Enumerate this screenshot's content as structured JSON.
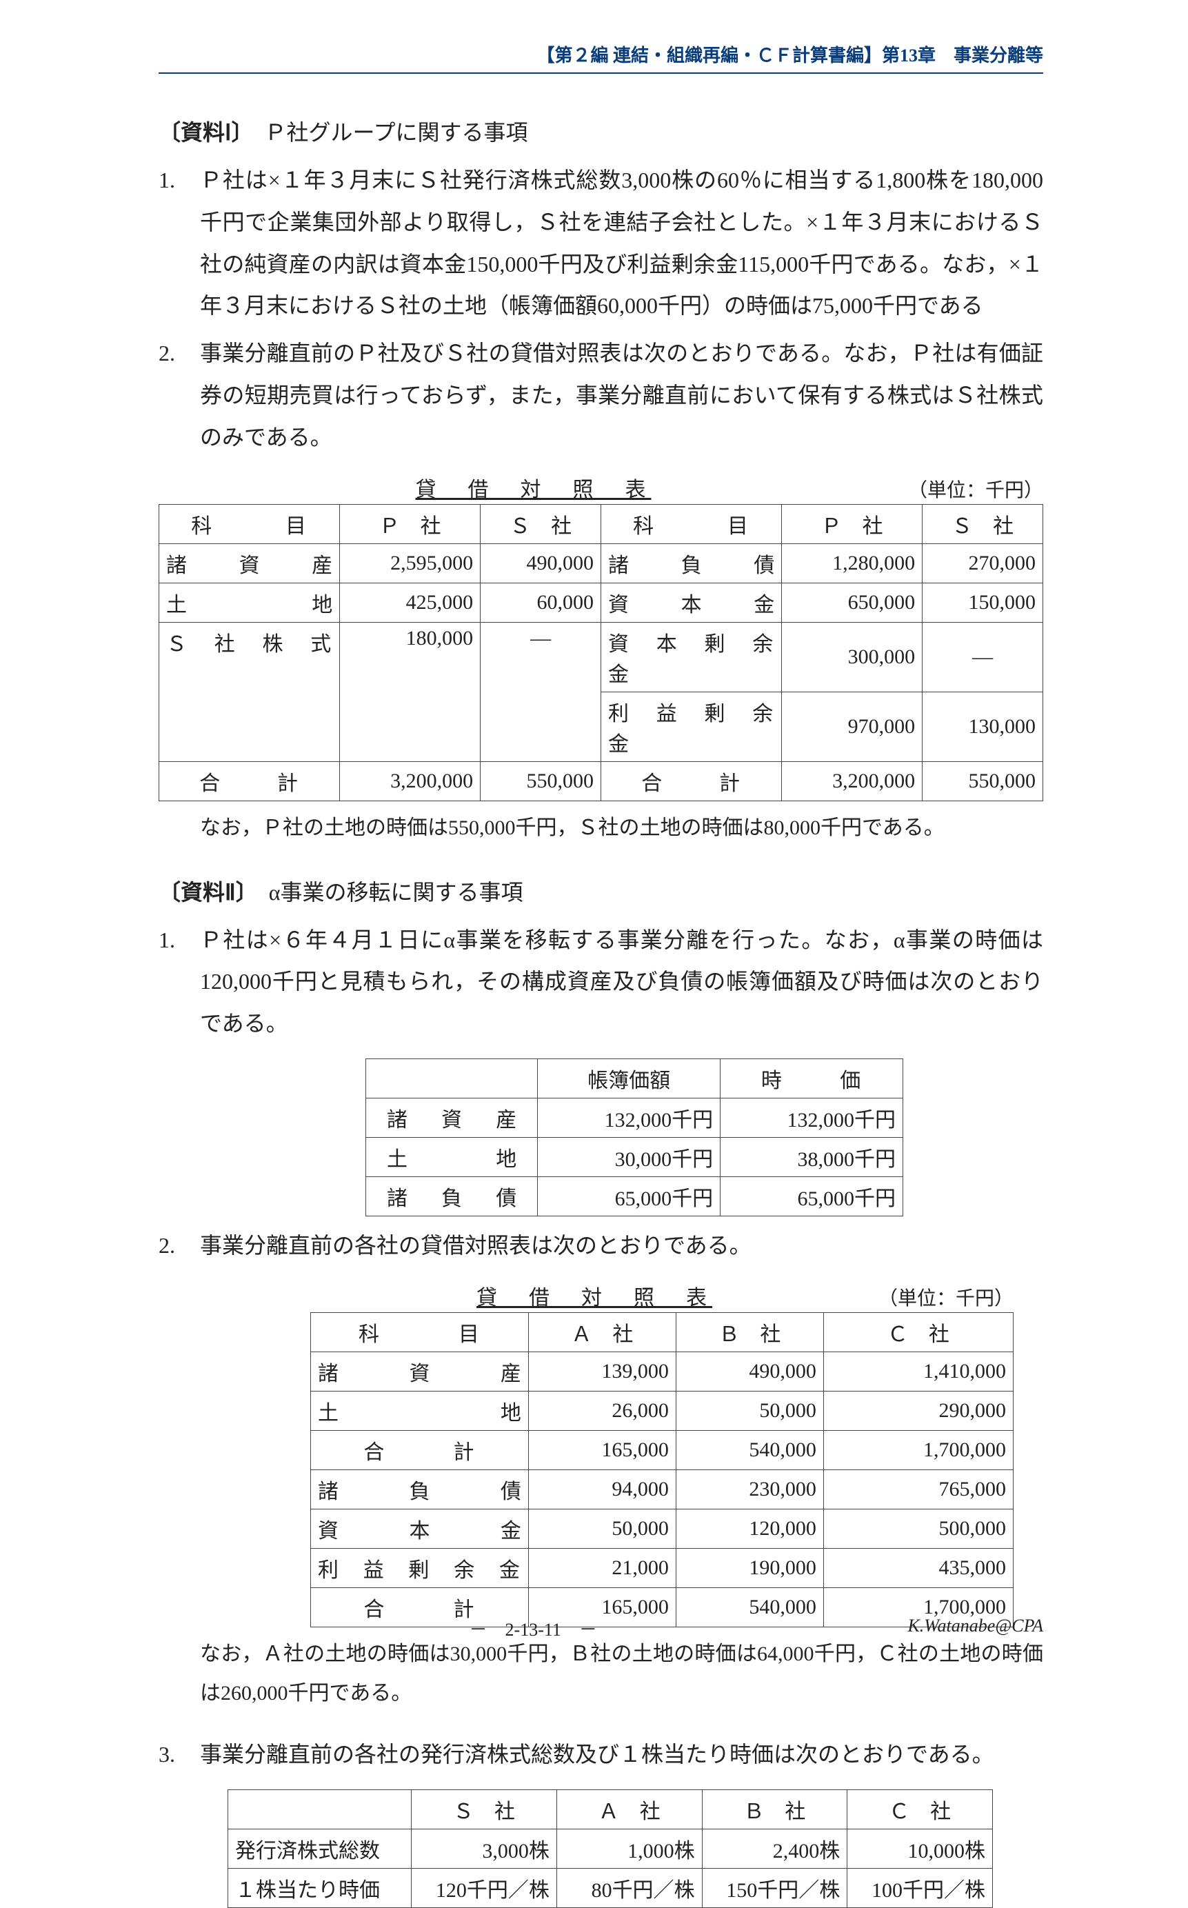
{
  "header": "【第２編 連結・組織再編・ＣＦ計算書編】第13章　事業分離等",
  "sec1": {
    "title_tag": "〔資料Ⅰ〕",
    "title_text": "　Ｐ社グループに関する事項",
    "li1_num": "1.",
    "li1": "Ｐ社は×１年３月末にＳ社発行済株式総数3,000株の60％に相当する1,800株を180,000千円で企業集団外部より取得し，Ｓ社を連結子会社とした。×１年３月末におけるＳ社の純資産の内訳は資本金150,000千円及び利益剰余金115,000千円である。なお，×１年３月末におけるＳ社の土地（帳簿価額60,000千円）の時価は75,000千円である",
    "li2_num": "2.",
    "li2": "事業分離直前のＰ社及びＳ社の貸借対照表は次のとおりである。なお，Ｐ社は有価証券の短期売買は行っておらず，また，事業分離直前において保有する株式はＳ社株式のみである。"
  },
  "table1": {
    "title": "貸　借　対　照　表",
    "unit": "（単位：千円）",
    "h1": "科　　目",
    "h2": "Ｐ　社",
    "h3": "Ｓ　社",
    "h4": "科　　目",
    "h5": "Ｐ　社",
    "h6": "Ｓ　社",
    "r1a_l": "諸",
    "r1a_c": "資",
    "r1a_r": "産",
    "r1p": "2,595,000",
    "r1s": "490,000",
    "r1b_l": "諸",
    "r1b_c": "負",
    "r1b_r": "債",
    "r1pp": "1,280,000",
    "r1ss": "270,000",
    "r2a_l": "土",
    "r2a_r": "地",
    "r2p": "425,000",
    "r2s": "60,000",
    "r2b_l": "資",
    "r2b_c": "本",
    "r2b_r": "金",
    "r2pp": "650,000",
    "r2ss": "150,000",
    "r3a": "Ｓ　社　株　式",
    "r3p": "180,000",
    "r3s": "―",
    "r3b": "資　本　剰　余　金",
    "r3pp": "300,000",
    "r3ss": "―",
    "r4b": "利　益　剰　余　金",
    "r4pp": "970,000",
    "r4ss": "130,000",
    "r5a": "合　　計",
    "r5p": "3,200,000",
    "r5s": "550,000",
    "r5b": "合　　計",
    "r5pp": "3,200,000",
    "r5ss": "550,000",
    "note": "なお，Ｐ社の土地の時価は550,000千円，Ｓ社の土地の時価は80,000千円である。"
  },
  "sec2": {
    "title_tag": "〔資料Ⅱ〕",
    "title_text": "　α事業の移転に関する事項",
    "li1_num": "1.",
    "li1": "Ｐ社は×６年４月１日にα事業を移転する事業分離を行った。なお，α事業の時価は120,000千円と見積もられ，その構成資産及び負債の帳簿価額及び時価は次のとおりである。",
    "li2_num": "2.",
    "li2": "事業分離直前の各社の貸借対照表は次のとおりである。",
    "li3_num": "3.",
    "li3": "事業分離直前の各社の発行済株式総数及び１株当たり時価は次のとおりである。"
  },
  "table2": {
    "h1": "帳簿価額",
    "h2": "時　　価",
    "r1l": "諸",
    "r1c": "資",
    "r1r": "産",
    "r1a": "132,000千円",
    "r1b": "132,000千円",
    "r2l": "土",
    "r2r": "地",
    "r2a": "30,000千円",
    "r2b": "38,000千円",
    "r3l": "諸",
    "r3c": "負",
    "r3r": "債",
    "r3a": "65,000千円",
    "r3b": "65,000千円"
  },
  "table3": {
    "title": "貸　借　対　照　表",
    "unit": "（単位：千円）",
    "h1": "科　　目",
    "h2": "Ａ　社",
    "h3": "Ｂ　社",
    "h4": "Ｃ　社",
    "r1l": "諸",
    "r1c": "資",
    "r1r": "産",
    "r1a": "139,000",
    "r1b": "490,000",
    "r1c2": "1,410,000",
    "r2l": "土",
    "r2r": "地",
    "r2a": "26,000",
    "r2b": "50,000",
    "r2c": "290,000",
    "r3": "合　　計",
    "r3a": "165,000",
    "r3b": "540,000",
    "r3c": "1,700,000",
    "r4l": "諸",
    "r4c": "負",
    "r4r": "債",
    "r4a": "94,000",
    "r4b": "230,000",
    "r4c2": "765,000",
    "r5l": "資",
    "r5c": "本",
    "r5r": "金",
    "r5a": "50,000",
    "r5b": "120,000",
    "r5c2": "500,000",
    "r6": "利　益　剰　余　金",
    "r6a": "21,000",
    "r6b": "190,000",
    "r6c": "435,000",
    "r7": "合　　計",
    "r7a": "165,000",
    "r7b": "540,000",
    "r7c": "1,700,000",
    "note": "なお，Ａ社の土地の時価は30,000千円，Ｂ社の土地の時価は64,000千円，Ｃ社の土地の時価は260,000千円である。"
  },
  "table4": {
    "h1": "Ｓ　社",
    "h2": "Ａ　社",
    "h3": "Ｂ　社",
    "h4": "Ｃ　社",
    "r1": "発行済株式総数",
    "r1a": "3,000株",
    "r1b": "1,000株",
    "r1c": "2,400株",
    "r1d": "10,000株",
    "r2": "１株当たり時価",
    "r2a": "120千円／株",
    "r2b": "80千円／株",
    "r2c": "150千円／株",
    "r2d": "100千円／株"
  },
  "footer": {
    "page": "－　2-13-11　－",
    "author": "K.Watanabe@CPA"
  }
}
